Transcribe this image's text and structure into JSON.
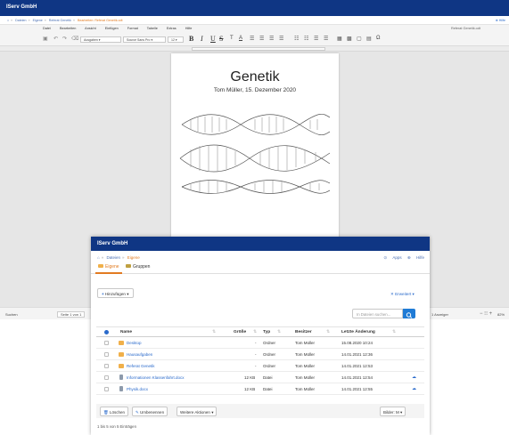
{
  "editor": {
    "app_title": "IServ GmbH",
    "breadcrumb": [
      "Dateien",
      "Eigene",
      "Referat Genetik",
      "Bearbeiten: Referat Genetik.odt"
    ],
    "help": "Hilfe",
    "menu": [
      "Datei",
      "Bearbeiten",
      "Ansicht",
      "Einfügen",
      "Format",
      "Tabelle",
      "Extras",
      "Hilfe"
    ],
    "document_name": "Referat Genetik.odt",
    "paragraph_style": "Ausgaben",
    "font_name": "Source Sans Pro",
    "font_size": "12",
    "format_buttons": [
      "B",
      "I",
      "U",
      "S"
    ],
    "status": {
      "search": "Suchen",
      "page": "Seite 1 von 1",
      "zoom_mode": "1 Anzeiger",
      "zoom": "82%"
    },
    "page": {
      "title": "Genetik",
      "subtitle": "Tom Müller, 15. Dezember 2020"
    }
  },
  "file_manager": {
    "app_title": "IServ GmbH",
    "breadcrumb": [
      "Dateien",
      "Eigene"
    ],
    "links": [
      "Apps",
      "Hilfe"
    ],
    "tabs": [
      "Eigene",
      "Gruppen"
    ],
    "add_button": "Hinzufügen",
    "extended_button": "Erweitert",
    "search_placeholder": "In Dateien suchen...",
    "columns": [
      "Name",
      "Größe",
      "Typ",
      "Besitzer",
      "Letzte Änderung"
    ],
    "rows": [
      {
        "name": "Desktop",
        "size": "-",
        "type": "Ordner",
        "owner": "Tom Müller",
        "modified": "15.08.2020 10:24",
        "kind": "folder"
      },
      {
        "name": "Hausaufgaben",
        "size": "-",
        "type": "Ordner",
        "owner": "Tom Müller",
        "modified": "14.01.2021 12:36",
        "kind": "folder"
      },
      {
        "name": "Referat Genetik",
        "size": "-",
        "type": "Ordner",
        "owner": "Tom Müller",
        "modified": "14.01.2021 12:53",
        "kind": "folder"
      },
      {
        "name": "Informationen Klassenfahrt.docx",
        "size": "12 KB",
        "type": "Datei",
        "owner": "Tom Müller",
        "modified": "14.01.2021 12:54",
        "kind": "file"
      },
      {
        "name": "Physik.docx",
        "size": "12 KB",
        "type": "Datei",
        "owner": "Tom Müller",
        "modified": "14.01.2021 12:55",
        "kind": "file"
      }
    ],
    "actions": {
      "delete": "Löschen",
      "rename": "Umbenennen",
      "more": "Weitere Aktionen",
      "images": "Bilder: M"
    },
    "count_text": "1 bis 5 von 5 Einträgen",
    "accent": "#e27b21",
    "brand": "#0f3684"
  }
}
